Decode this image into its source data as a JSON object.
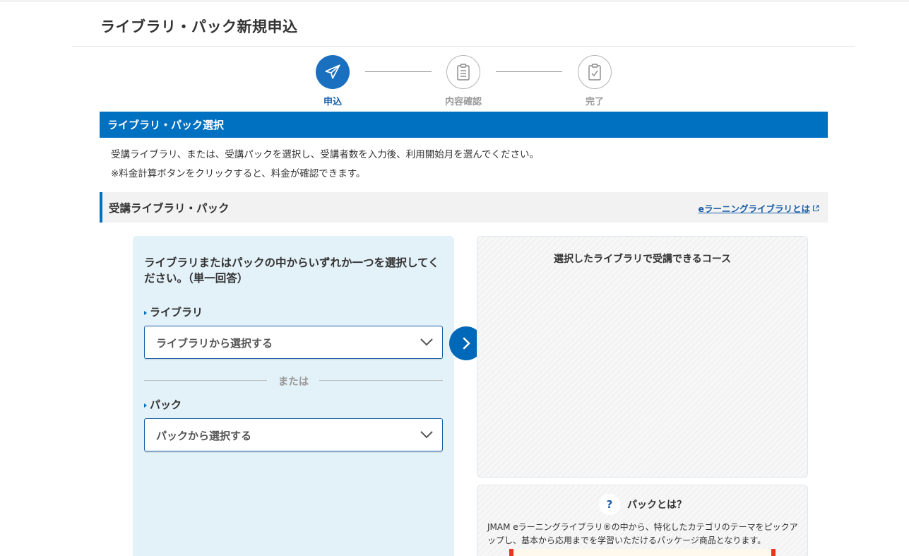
{
  "page": {
    "title": "ライブラリ・パック新規申込"
  },
  "steps": [
    {
      "label": "申込",
      "active": true,
      "icon": "paper-plane-icon"
    },
    {
      "label": "内容確認",
      "active": false,
      "icon": "clipboard-icon"
    },
    {
      "label": "完了",
      "active": false,
      "icon": "clipboard-check-icon"
    }
  ],
  "section": {
    "title": "ライブラリ・パック選択",
    "intro_line1": "受講ライブラリ、または、受講パックを選択し、受講者数を入力後、利用開始月を選んでください。",
    "intro_line2": "※料金計算ボタンをクリックすると、料金が確認できます。"
  },
  "subsection": {
    "title": "受講ライブラリ・パック",
    "link": "eラーニングライブラリとは"
  },
  "form": {
    "instruction": "ライブラリまたはパックの中からいずれか一つを選択してください。（単一回答）",
    "library_label": "ライブラリ",
    "library_select": "ライブラリから選択する",
    "or_text": "または",
    "pack_label": "パック",
    "pack_select": "パックから選択する"
  },
  "courses_panel": {
    "title": "選択したライブラリで受講できるコース"
  },
  "pack_info": {
    "title": "パックとは？",
    "q": "?",
    "description": "JMAM eラーニングライブラリ®の中から、特化したカテゴリのテーマをピックアップし、基本から応用までを学習いただけるパッケージ商品となります。"
  },
  "colors": {
    "primary": "#0070c0",
    "panel_bg": "#e3f1f8",
    "accent_red": "#e8351e"
  }
}
